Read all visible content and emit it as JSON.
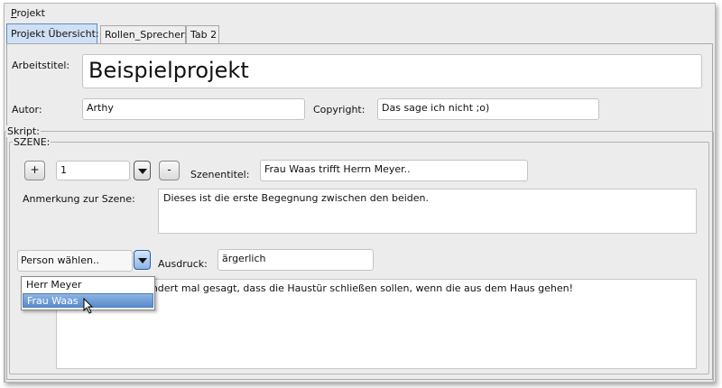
{
  "menubar": {
    "project_menu_mnemonic": "P",
    "project_menu_rest": "rojekt"
  },
  "tabs": [
    {
      "label": "Projekt Übersicht:"
    },
    {
      "label": "Rollen_Sprecher:"
    },
    {
      "label": "Tab 2"
    }
  ],
  "project": {
    "title_label": "Arbeitstitel:",
    "title_value": "Beispielprojekt",
    "author_label": "Autor:",
    "author_value": "Arthy",
    "copyright_label": "Copyright:",
    "copyright_value": "Das sage ich nicht ;o)"
  },
  "script": {
    "group_label": "Skript:",
    "scene_group_label": "SZENE:",
    "add_label": "+",
    "remove_label": "-",
    "scene_number": "1",
    "scene_title_label": "Szenentitel:",
    "scene_title_value": "Frau Waas trifft Herrn Meyer..",
    "note_label": "Anmerkung zur Szene:",
    "note_value": "Dieses ist die erste Begegnung zwischen den beiden.",
    "person_combo_value": "Person wählen..",
    "expression_label": "Ausdruck:",
    "expression_value": "ärgerlich",
    "dialogue_text": "e ihnen bereits hundert mal gesagt, dass die Haustür schließen sollen, wenn die aus dem Haus gehen!"
  },
  "person_dropdown": {
    "options": [
      "Herr Meyer",
      "Frau Waas"
    ],
    "selected": "Frau Waas"
  },
  "colors": {
    "active_tab": "#cfe0f4",
    "selection": "#5a8ccc",
    "window_background": "#ececec"
  },
  "icons": {
    "mouse_cursor": "arrow-cursor-icon",
    "dropdown": "triangle-down-icon"
  }
}
